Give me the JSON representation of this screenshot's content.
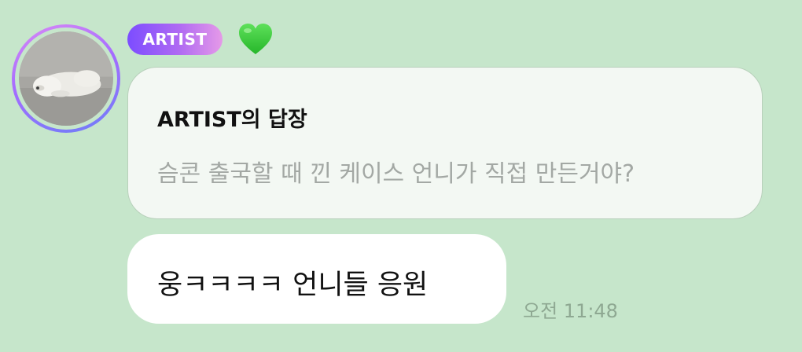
{
  "sender": {
    "badge_label": "ARTIST",
    "avatar_icon": "dog-photo-avatar",
    "reaction_icon": "green-heart-icon"
  },
  "reply": {
    "title": "ARTIST의 답장",
    "quoted_text": "슴콘 출국할 때 낀 케이스 언니가 직접 만든거야?"
  },
  "message": {
    "text": "웅ㅋㅋㅋㅋ 언니들 응원",
    "time": "오전 11:48"
  },
  "colors": {
    "background": "#c6e6cb",
    "bubble": "#ffffff",
    "reply_card": "#f3f8f3",
    "badge_start": "#7c4dff",
    "badge_end": "#e59ae8",
    "heart": "#3ecf3e",
    "timestamp": "#8ea892"
  }
}
